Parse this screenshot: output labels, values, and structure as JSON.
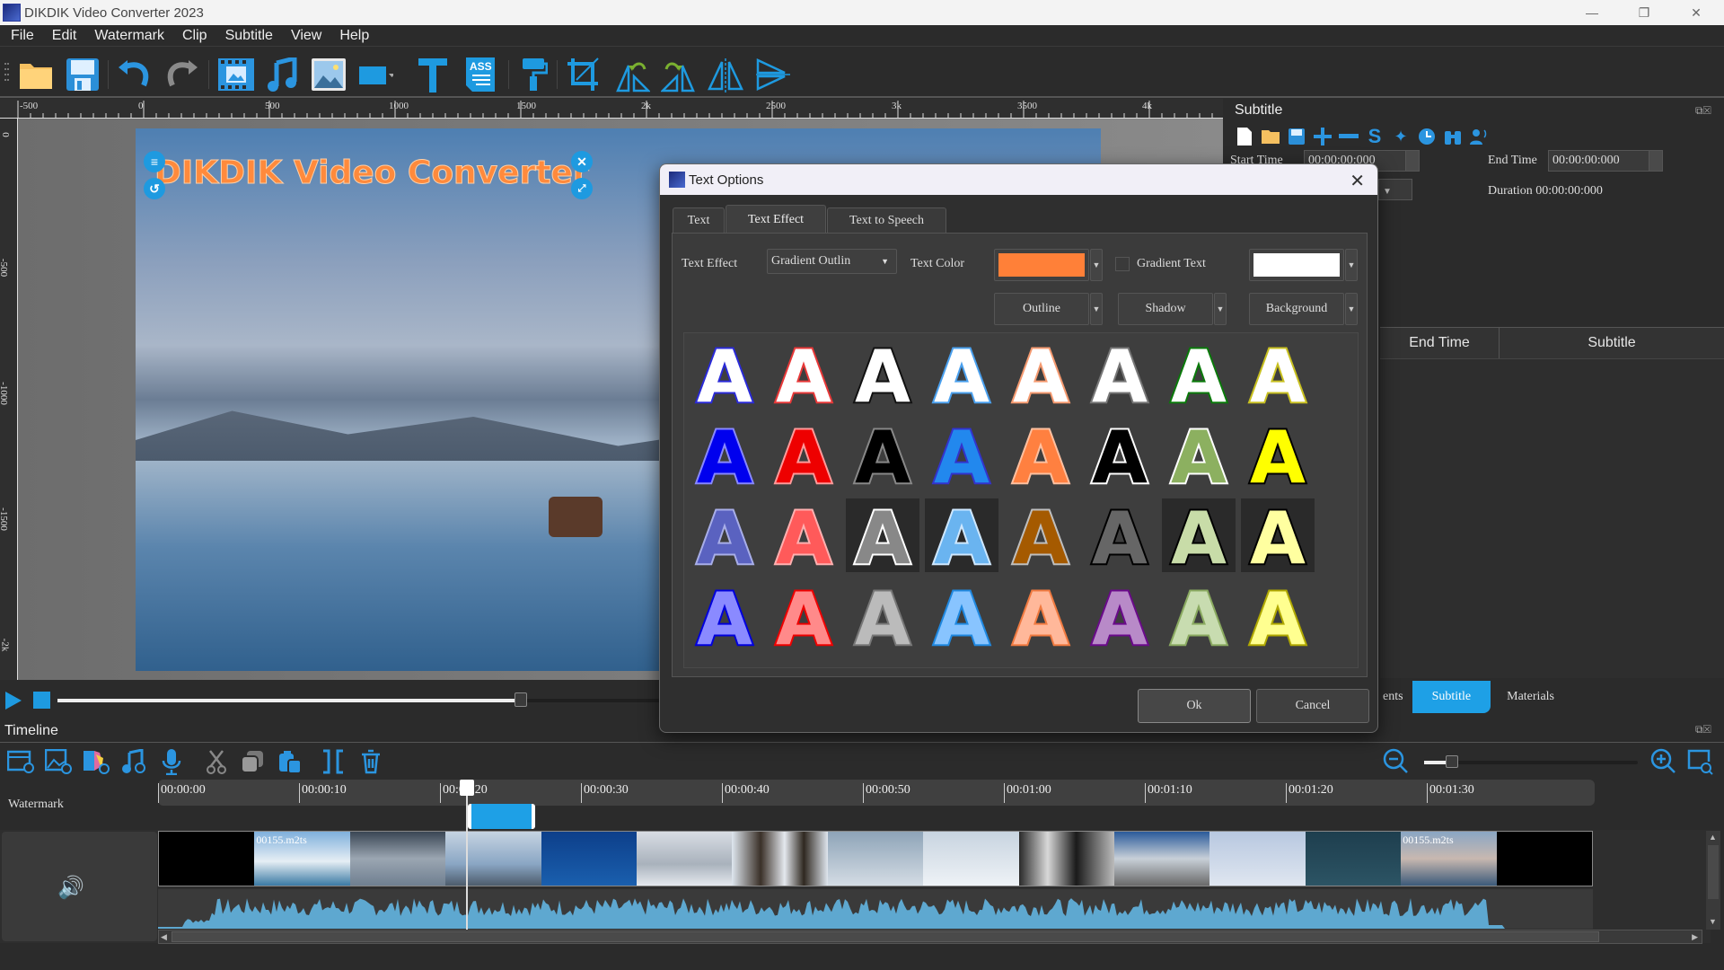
{
  "window": {
    "title": "DIKDIK Video Converter 2023",
    "controls": [
      "minimize",
      "restore",
      "close"
    ]
  },
  "menu": [
    "File",
    "Edit",
    "Watermark",
    "Clip",
    "Subtitle",
    "View",
    "Help"
  ],
  "toolbar": {
    "icons": [
      "open-folder-icon",
      "save-icon",
      "undo-icon",
      "redo-icon",
      "add-video-icon",
      "add-music-icon",
      "add-image-icon",
      "shape-icon",
      "text-icon",
      "ass-subtitle-icon",
      "paint-roller-icon",
      "crop-icon",
      "rotate-left-icon",
      "rotate-right-icon",
      "flip-horizontal-icon",
      "flip-vertical-icon"
    ],
    "ass_label": "ASS"
  },
  "ruler": {
    "horizontal": [
      "-500",
      "0",
      "500",
      "1000",
      "1500",
      "2k",
      "2500",
      "3k",
      "3500",
      "4k"
    ],
    "vertical": [
      "0",
      "-500",
      "-1000",
      "-1500",
      "-2k"
    ]
  },
  "preview": {
    "watermark_text": "DIKDIK Video Converter",
    "watermark_color": "#ff8a3c",
    "progress": 0.4
  },
  "subtitle_panel": {
    "title": "Subtitle",
    "start_time_label": "Start Time",
    "start_time": "00:00:00:000",
    "end_time_label": "End Time",
    "end_time": "00:00:00:000",
    "duration_label": "Duration",
    "duration": "00:00:00:000",
    "table_headers": [
      "End Time",
      "Subtitle"
    ],
    "rows": []
  },
  "bottom_tabs": [
    {
      "label": "ents",
      "active": false
    },
    {
      "label": "Subtitle",
      "active": true
    },
    {
      "label": "Materials",
      "active": false
    }
  ],
  "dialog": {
    "title": "Text Options",
    "tabs": [
      {
        "label": "Text",
        "active": false
      },
      {
        "label": "Text Effect",
        "active": true
      },
      {
        "label": "Text to Speech",
        "active": false
      }
    ],
    "text_effect_label": "Text Effect",
    "text_effect_value": "Gradient Outlin",
    "text_color_label": "Text Color",
    "text_color": "#ff8038",
    "gradient_text_label": "Gradient Text",
    "gradient_text_checked": false,
    "gradient_color": "#ffffff",
    "outline_label": "Outline",
    "shadow_label": "Shadow",
    "background_label": "Background",
    "ok_label": "Ok",
    "cancel_label": "Cancel",
    "presets": [
      [
        {
          "fill": "#ffffff",
          "stroke": "#2a2ad8"
        },
        {
          "fill": "#ffffff",
          "stroke": "#e83838"
        },
        {
          "fill": "#ffffff",
          "stroke": "#111111"
        },
        {
          "fill": "#ffffff",
          "stroke": "#4aa0ee"
        },
        {
          "fill": "#ffffff",
          "stroke": "#f59a70"
        },
        {
          "fill": "#ffffff",
          "stroke": "#777777"
        },
        {
          "fill": "#ffffff",
          "stroke": "#0a7a0a"
        },
        {
          "fill": "#ffffff",
          "stroke": "#c8c020"
        }
      ],
      [
        {
          "fill": "#0000ee",
          "stroke": "#8888ff"
        },
        {
          "fill": "#ee0000",
          "stroke": "#ff9a9a"
        },
        {
          "fill": "#000000",
          "stroke": "#888888"
        },
        {
          "fill": "#2288ee",
          "stroke": "#3333cc"
        },
        {
          "fill": "#ff8040",
          "stroke": "#ffc0a0"
        },
        {
          "fill": "#000000",
          "stroke": "#ffffff"
        },
        {
          "fill": "#8cb060",
          "stroke": "#ffffff"
        },
        {
          "fill": "#ffff00",
          "stroke": "#000000"
        }
      ],
      [
        {
          "fill": "#5a62c0",
          "stroke": "#a8aee8"
        },
        {
          "fill": "#ff5a5a",
          "stroke": "#ffb0b0"
        },
        {
          "fill": "#888888",
          "stroke": "#ffffff",
          "bg": "#2a2a2a"
        },
        {
          "fill": "#6ab4f0",
          "stroke": "#cfe8ff",
          "bg": "#2a2a2a"
        },
        {
          "fill": "#a55a00",
          "stroke": "#bfbfbf"
        },
        {
          "fill": "#666666",
          "stroke": "#000000"
        },
        {
          "fill": "#c8dca8",
          "stroke": "#000000",
          "bg": "#2a2a2a"
        },
        {
          "fill": "#ffffa0",
          "stroke": "#000000",
          "bg": "#2a2a2a"
        }
      ],
      [
        {
          "fill": "#8a8aff",
          "stroke": "#0000dd"
        },
        {
          "fill": "#ff8a8a",
          "stroke": "#ee0000"
        },
        {
          "fill": "#bbbbbb",
          "stroke": "#777777"
        },
        {
          "fill": "#88c4ff",
          "stroke": "#1f88e0"
        },
        {
          "fill": "#ffb89a",
          "stroke": "#f07a40"
        },
        {
          "fill": "#b88ac8",
          "stroke": "#6a0a8a"
        },
        {
          "fill": "#c8dcb0",
          "stroke": "#8aaa60"
        },
        {
          "fill": "#ffff90",
          "stroke": "#b0a800"
        }
      ]
    ]
  },
  "timeline": {
    "title": "Timeline",
    "tools": [
      "add-video-icon",
      "add-image-icon",
      "add-effect-icon",
      "add-music-icon",
      "record-mic-icon",
      "cut-icon",
      "copy-icon",
      "paste-icon",
      "split-icon",
      "delete-icon"
    ],
    "ticks": [
      "00:00:00",
      "00:00:10",
      "00:00:20",
      "00:00:30",
      "00:00:40",
      "00:00:50",
      "00:01:00",
      "00:01:10",
      "00:01:20",
      "00:01:30"
    ],
    "watermark_label": "Watermark",
    "clip_label": "00155.m2ts",
    "zoom_level": 0.1
  }
}
